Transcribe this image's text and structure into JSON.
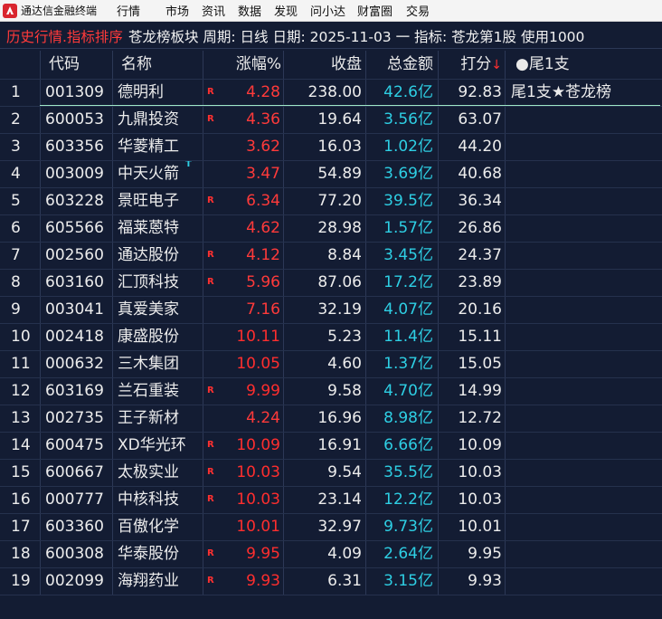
{
  "app": {
    "title": "通达信金融终端",
    "menu": [
      "行情",
      "市场",
      "资讯",
      "数据",
      "发现",
      "问小达",
      "财富圈",
      "交易"
    ]
  },
  "titlebar": {
    "section": "历史行情.指标排序",
    "info": "苍龙榜板块 周期: 日线 日期: 2025-11-03 一 指标: 苍龙第1股  使用1000"
  },
  "table": {
    "headers": {
      "code": "代码",
      "name": "名称",
      "change": "涨幅%",
      "close": "收盘",
      "amount": "总金额",
      "score": "打分",
      "sort_arrow": "↓",
      "note": "●尾1支"
    },
    "rows": [
      {
        "idx": "1",
        "code": "001309",
        "name": "德明利",
        "badge": "R",
        "change": "4.28",
        "close": "238.00",
        "amount": "42.6亿",
        "score": "92.83",
        "note": "尾1支★苍龙榜"
      },
      {
        "idx": "2",
        "code": "600053",
        "name": "九鼎投资",
        "badge": "R",
        "change": "4.36",
        "close": "19.64",
        "amount": "3.56亿",
        "score": "63.07",
        "note": ""
      },
      {
        "idx": "3",
        "code": "603356",
        "name": "华菱精工",
        "badge": "",
        "change": "3.62",
        "close": "16.03",
        "amount": "1.02亿",
        "score": "44.20",
        "note": ""
      },
      {
        "idx": "4",
        "code": "003009",
        "name": "中天火箭",
        "badge": "T",
        "change": "3.47",
        "close": "54.89",
        "amount": "3.69亿",
        "score": "40.68",
        "note": ""
      },
      {
        "idx": "5",
        "code": "603228",
        "name": "景旺电子",
        "badge": "R",
        "change": "6.34",
        "close": "77.20",
        "amount": "39.5亿",
        "score": "36.34",
        "note": ""
      },
      {
        "idx": "6",
        "code": "605566",
        "name": "福莱蒽特",
        "badge": "",
        "change": "4.62",
        "close": "28.98",
        "amount": "1.57亿",
        "score": "26.86",
        "note": ""
      },
      {
        "idx": "7",
        "code": "002560",
        "name": "通达股份",
        "badge": "R",
        "change": "4.12",
        "close": "8.84",
        "amount": "3.45亿",
        "score": "24.37",
        "note": ""
      },
      {
        "idx": "8",
        "code": "603160",
        "name": "汇顶科技",
        "badge": "R",
        "change": "5.96",
        "close": "87.06",
        "amount": "17.2亿",
        "score": "23.89",
        "note": ""
      },
      {
        "idx": "9",
        "code": "003041",
        "name": "真爱美家",
        "badge": "",
        "change": "7.16",
        "close": "32.19",
        "amount": "4.07亿",
        "score": "20.16",
        "note": ""
      },
      {
        "idx": "10",
        "code": "002418",
        "name": "康盛股份",
        "badge": "",
        "change": "10.11",
        "close": "5.23",
        "amount": "11.4亿",
        "score": "15.11",
        "note": ""
      },
      {
        "idx": "11",
        "code": "000632",
        "name": "三木集团",
        "badge": "",
        "change": "10.05",
        "close": "4.60",
        "amount": "1.37亿",
        "score": "15.05",
        "note": ""
      },
      {
        "idx": "12",
        "code": "603169",
        "name": "兰石重装",
        "badge": "R",
        "change": "9.99",
        "close": "9.58",
        "amount": "4.70亿",
        "score": "14.99",
        "note": ""
      },
      {
        "idx": "13",
        "code": "002735",
        "name": "王子新材",
        "badge": "",
        "change": "4.24",
        "close": "16.96",
        "amount": "8.98亿",
        "score": "12.72",
        "note": ""
      },
      {
        "idx": "14",
        "code": "600475",
        "name": "XD华光环",
        "badge": "R",
        "change": "10.09",
        "close": "16.91",
        "amount": "6.66亿",
        "score": "10.09",
        "note": ""
      },
      {
        "idx": "15",
        "code": "600667",
        "name": "太极实业",
        "badge": "R",
        "change": "10.03",
        "close": "9.54",
        "amount": "35.5亿",
        "score": "10.03",
        "note": ""
      },
      {
        "idx": "16",
        "code": "000777",
        "name": "中核科技",
        "badge": "R",
        "change": "10.03",
        "close": "23.14",
        "amount": "12.2亿",
        "score": "10.03",
        "note": ""
      },
      {
        "idx": "17",
        "code": "603360",
        "name": "百傲化学",
        "badge": "",
        "change": "10.01",
        "close": "32.97",
        "amount": "9.73亿",
        "score": "10.01",
        "note": ""
      },
      {
        "idx": "18",
        "code": "600308",
        "name": "华泰股份",
        "badge": "R",
        "change": "9.95",
        "close": "4.09",
        "amount": "2.64亿",
        "score": "9.95",
        "note": ""
      },
      {
        "idx": "19",
        "code": "002099",
        "name": "海翔药业",
        "badge": "R",
        "change": "9.93",
        "close": "6.31",
        "amount": "3.15亿",
        "score": "9.93",
        "note": ""
      }
    ]
  },
  "icons": {
    "logo": "app-logo-icon"
  },
  "colors": {
    "background": "#131c33",
    "up_red": "#ff3a3a",
    "amount_cyan": "#2ecfe4",
    "grid_line": "#2c3856",
    "selection_line": "#9ee6c6"
  }
}
